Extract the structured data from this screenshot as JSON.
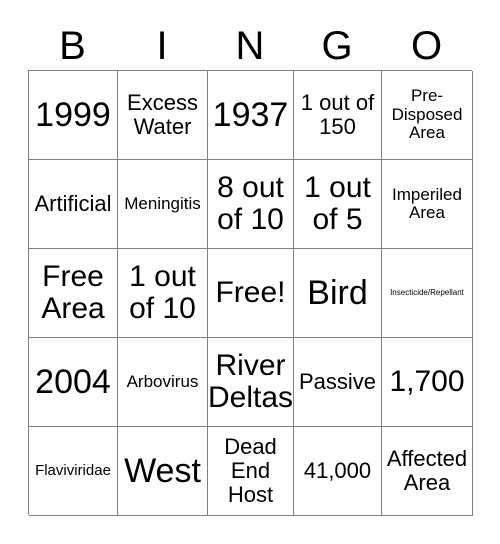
{
  "card": {
    "title": "BINGO",
    "headers": [
      "B",
      "I",
      "N",
      "G",
      "O"
    ],
    "rows": [
      [
        {
          "text": "1999",
          "size": "fs-xl"
        },
        {
          "text": "Excess Water",
          "size": "fs-md"
        },
        {
          "text": "1937",
          "size": "fs-xl"
        },
        {
          "text": "1 out of 150",
          "size": "fs-md"
        },
        {
          "text": "Pre-Disposed Area",
          "size": "fs-sm"
        }
      ],
      [
        {
          "text": "Artificial",
          "size": "fs-md"
        },
        {
          "text": "Meningitis",
          "size": "fs-sm"
        },
        {
          "text": "8 out of 10",
          "size": "fs-lg"
        },
        {
          "text": "1 out of 5",
          "size": "fs-lg"
        },
        {
          "text": "Imperiled Area",
          "size": "fs-sm"
        }
      ],
      [
        {
          "text": "Free Area",
          "size": "fs-lg"
        },
        {
          "text": "1 out of 10",
          "size": "fs-lg"
        },
        {
          "text": "Free!",
          "size": "fs-lg"
        },
        {
          "text": "Bird",
          "size": "fs-xl"
        },
        {
          "text": "Insecticide/Repellant",
          "size": "fs-xxs"
        }
      ],
      [
        {
          "text": "2004",
          "size": "fs-xl"
        },
        {
          "text": "Arbovirus",
          "size": "fs-sm"
        },
        {
          "text": "River Deltas",
          "size": "fs-lg"
        },
        {
          "text": "Passive",
          "size": "fs-md"
        },
        {
          "text": "1,700",
          "size": "fs-lg"
        }
      ],
      [
        {
          "text": "Flaviviridae",
          "size": "fs-xs"
        },
        {
          "text": "West",
          "size": "fs-xl"
        },
        {
          "text": "Dead End Host",
          "size": "fs-md"
        },
        {
          "text": "41,000",
          "size": "fs-md"
        },
        {
          "text": "Affected Area",
          "size": "fs-md"
        }
      ]
    ]
  },
  "colors": {
    "grid_line": "#808080",
    "text": "#000000",
    "background": "#ffffff"
  }
}
